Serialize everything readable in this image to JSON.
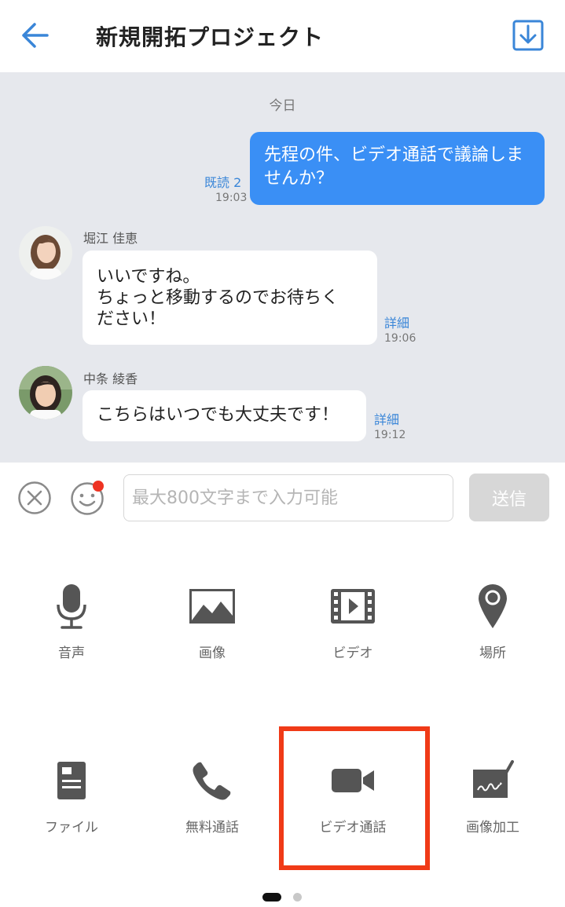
{
  "header": {
    "title": "新規開拓プロジェクト",
    "back_icon": "arrow-left-icon",
    "download_icon": "download-icon",
    "accent": "#3a86d8"
  },
  "chat": {
    "date_label": "今日",
    "messages": [
      {
        "direction": "out",
        "text": "先程の件、ビデオ通話で議論しませんか？",
        "read_label": "既読 2",
        "time": "19:03"
      },
      {
        "direction": "in",
        "sender": "堀江 佳恵",
        "text_lines": [
          "いいですね。",
          "ちょっと移動するのでお待ちく",
          "ださい！"
        ],
        "detail_label": "詳細",
        "time": "19:06"
      },
      {
        "direction": "in",
        "sender": "中条 綾香",
        "text": "こちらはいつでも大丈夫です！",
        "detail_label": "詳細",
        "time": "19:12"
      }
    ]
  },
  "input_bar": {
    "placeholder": "最大800文字まで入力可能",
    "send_label": "送信"
  },
  "attachments": [
    {
      "label": "音声",
      "icon": "microphone-icon"
    },
    {
      "label": "画像",
      "icon": "image-icon"
    },
    {
      "label": "ビデオ",
      "icon": "video-film-icon"
    },
    {
      "label": "場所",
      "icon": "location-pin-icon"
    },
    {
      "label": "ファイル",
      "icon": "file-icon"
    },
    {
      "label": "無料通話",
      "icon": "phone-icon"
    },
    {
      "label": "ビデオ通話",
      "icon": "video-camera-icon"
    },
    {
      "label": "画像加工",
      "icon": "image-edit-icon"
    }
  ],
  "pager": {
    "pages": 2,
    "active": 1
  }
}
